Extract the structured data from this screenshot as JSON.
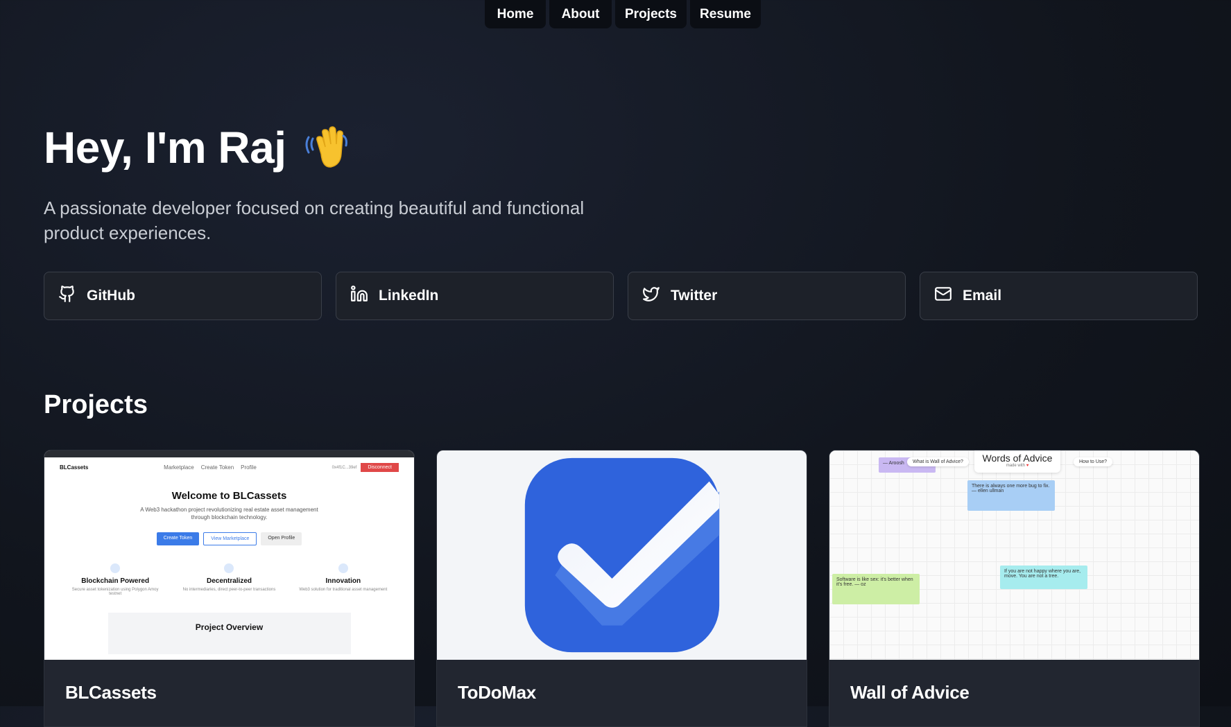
{
  "nav": {
    "items": [
      {
        "label": "Home",
        "width": 88
      },
      {
        "label": "About",
        "width": 90
      },
      {
        "label": "Projects",
        "width": 103
      },
      {
        "label": "Resume",
        "width": 102
      }
    ]
  },
  "hero": {
    "title": "Hey, I'm Raj",
    "subtitle": "A passionate developer focused on creating beautiful and functional product experiences."
  },
  "socials": [
    {
      "label": "GitHub",
      "icon": "github-icon"
    },
    {
      "label": "LinkedIn",
      "icon": "linkedin-icon"
    },
    {
      "label": "Twitter",
      "icon": "twitter-icon"
    },
    {
      "label": "Email",
      "icon": "mail-icon"
    }
  ],
  "projects": {
    "title": "Projects",
    "items": [
      {
        "title": "BLCassets"
      },
      {
        "title": "ToDoMax"
      },
      {
        "title": "Wall of Advice"
      }
    ]
  },
  "blcassets_preview": {
    "brand": "BLCassets",
    "links": [
      "Marketplace",
      "Create Token",
      "Profile"
    ],
    "address": "0x4f1C...39ef",
    "disconnect": "Disconnect",
    "welcome": "Welcome to BLCassets",
    "description": "A Web3 hackathon project revolutionizing real estate asset management through blockchain technology.",
    "buttons": [
      "Create Token",
      "View Marketplace",
      "Open Profile"
    ],
    "features": [
      {
        "title": "Blockchain Powered",
        "sub": "Secure asset tokenization using Polygon Amoy testnet"
      },
      {
        "title": "Decentralized",
        "sub": "No intermediaries, direct peer-to-peer transactions"
      },
      {
        "title": "Innovation",
        "sub": "Web3 solution for traditional asset management"
      }
    ],
    "overview": "Project Overview"
  },
  "wall_preview": {
    "heading": "Words of Advice",
    "made_with": "made with",
    "pill_left": "What is Wall of Advice?",
    "pill_right": "How to Use?",
    "notes": [
      {
        "text": "— Aroosh",
        "color": "#c9b8f2"
      },
      {
        "text": "There is always one more bug to fix. — ellen ullman",
        "color": "#a8cef5"
      },
      {
        "text": "Software is like sex: it's better when it's free. — oz",
        "color": "#cdeea5"
      },
      {
        "text": "If you are not happy where you are, move. You are not a tree.",
        "color": "#a6ecee"
      }
    ]
  },
  "colors": {
    "background": "#11151d",
    "card": "#222630",
    "todo_blue": "#2f63dc",
    "accent_red": "#e04848"
  }
}
